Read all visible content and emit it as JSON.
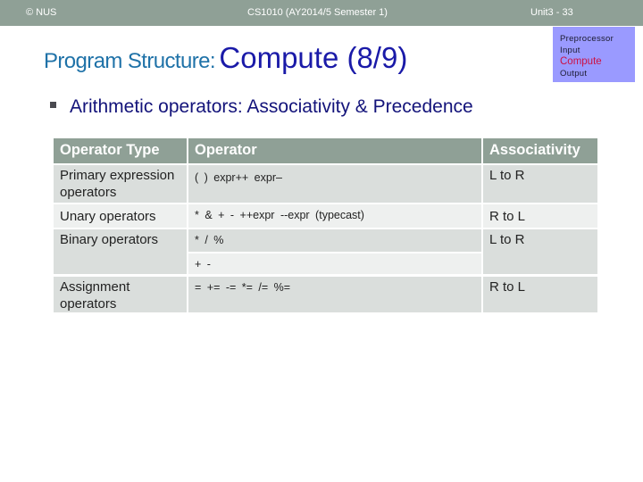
{
  "header": {
    "left": "© NUS",
    "center": "CS1010 (AY2014/5 Semester 1)",
    "right": "Unit3 - 33"
  },
  "nav": {
    "items": [
      "Preprocessor",
      "Input",
      "Compute",
      "Output"
    ],
    "current": "Compute",
    "current_color": "#cc1144"
  },
  "title": {
    "prefix": "Program Structure:",
    "main": "Compute (8/9)"
  },
  "bullet": "Arithmetic operators: Associativity & Precedence",
  "table": {
    "headers": [
      "Operator Type",
      "Operator",
      "Associativity"
    ],
    "rows": [
      {
        "type": "Primary expression operators",
        "operators": [
          "( )  expr++  expr–"
        ],
        "associativity": "L to R"
      },
      {
        "type": "Unary operators",
        "operators": [
          "*  &  +  -   ++expr  --expr  (typecast)"
        ],
        "associativity": "R to L"
      },
      {
        "type": "Binary operators",
        "operators": [
          "*  /  %",
          "+  -"
        ],
        "associativity": "L to R"
      },
      {
        "type": "Assignment operators",
        "operators": [
          "=  +=  -=  *=  /=  %="
        ],
        "associativity": "R to L"
      }
    ]
  }
}
